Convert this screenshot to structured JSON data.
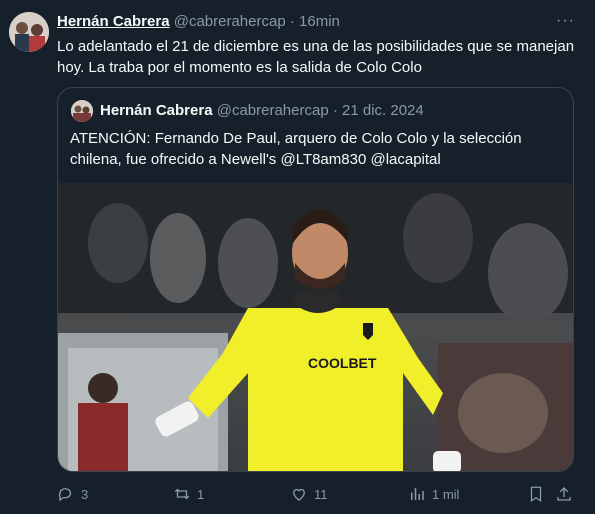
{
  "tweet": {
    "author_name": "Hernán Cabrera",
    "handle": "@cabrerahercap",
    "separator": "·",
    "time": "16min",
    "more_label": "···",
    "text": "Lo adelantado el 21 de diciembre es una de las posibilidades que se manejan hoy. La traba por el momento es la salida de Colo Colo"
  },
  "quoted": {
    "author_name": "Hernán Cabrera",
    "handle": "@cabrerahercap",
    "separator": "·",
    "date": "21 dic. 2024",
    "text": "ATENCIÓN: Fernando De Paul, arquero de Colo Colo y la selección chilena, fue ofrecido a Newell's @LT8am830 @lacapital",
    "photo": {
      "jersey_sponsor": "COOLBET",
      "jersey_color": "#f1ee2a"
    }
  },
  "actions": {
    "replies": "3",
    "retweets": "1",
    "likes": "11",
    "views": "1 mil"
  },
  "colors": {
    "background": "#15202b",
    "text": "#f7f9f9",
    "muted": "#8b98a5",
    "border": "#38444d"
  },
  "icons": [
    "reply-icon",
    "retweet-icon",
    "like-icon",
    "views-icon",
    "bookmark-icon",
    "share-icon",
    "more-icon"
  ]
}
